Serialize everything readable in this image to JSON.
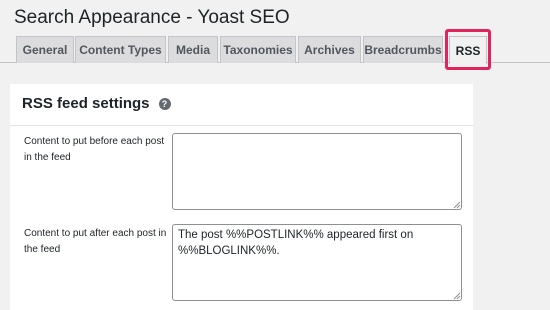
{
  "page": {
    "title": "Search Appearance - Yoast SEO"
  },
  "tabs": [
    {
      "label": "General"
    },
    {
      "label": "Content Types"
    },
    {
      "label": "Media"
    },
    {
      "label": "Taxonomies"
    },
    {
      "label": "Archives"
    },
    {
      "label": "Breadcrumbs"
    },
    {
      "label": "RSS",
      "active": true
    }
  ],
  "colors": {
    "highlight": "#e0245e",
    "tab_bg": "#dcdcde",
    "page_bg": "#f1f1f1"
  },
  "rss_settings": {
    "heading": "RSS feed settings",
    "help_icon": "question-circle-icon",
    "help_glyph": "?",
    "before_label": "Content to put before each post in the feed",
    "before_value": "",
    "after_label": "Content to put after each post in the feed",
    "after_value": "The post %%POSTLINK%% appeared first on %%BLOGLINK%%."
  }
}
